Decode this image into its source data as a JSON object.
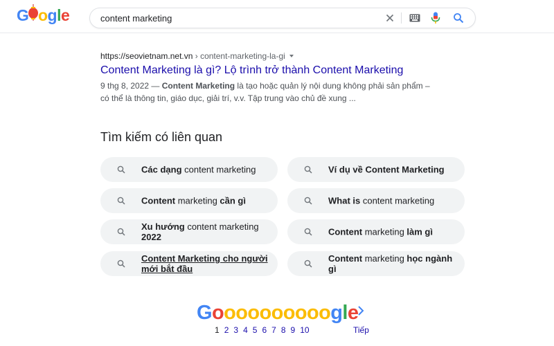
{
  "logo": {
    "text": "Google"
  },
  "search": {
    "query": "content marketing"
  },
  "result": {
    "domain": "https://seovietnam.net.vn",
    "path": " › content-marketing-la-gi",
    "title": "Content Marketing là gì? Lộ trình trở thành Content Marketing",
    "date": "9 thg 8, 2022 — ",
    "snippet_bold": "Content Marketing",
    "snippet_rest": " là tạo hoặc quản lý nội dung không phải sản phẩm – có thể là thông tin, giáo dục, giải trí, v.v. Tập trung vào chủ đề xung ..."
  },
  "related": {
    "title": "Tìm kiếm có liên quan",
    "items": [
      {
        "parts": [
          {
            "t": "Các dạng",
            "b": true
          },
          {
            "t": " content marketing",
            "b": false
          }
        ]
      },
      {
        "parts": [
          {
            "t": "Ví dụ về Content Marketing",
            "b": true
          }
        ]
      },
      {
        "parts": [
          {
            "t": "Content",
            "b": true
          },
          {
            "t": " marketing ",
            "b": false
          },
          {
            "t": "cần gì",
            "b": true
          }
        ]
      },
      {
        "parts": [
          {
            "t": "What is",
            "b": true
          },
          {
            "t": " content marketing",
            "b": false
          }
        ]
      },
      {
        "parts": [
          {
            "t": "Xu hướng",
            "b": true
          },
          {
            "t": " content marketing ",
            "b": false
          },
          {
            "t": "2022",
            "b": true
          }
        ]
      },
      {
        "parts": [
          {
            "t": "Content",
            "b": true
          },
          {
            "t": " marketing ",
            "b": false
          },
          {
            "t": "làm gì",
            "b": true
          }
        ]
      },
      {
        "parts": [
          {
            "t": "Content Marketing cho người mới bắt đầu",
            "b": true
          }
        ],
        "underline": true
      },
      {
        "parts": [
          {
            "t": "Content",
            "b": true
          },
          {
            "t": " marketing ",
            "b": false
          },
          {
            "t": "học ngành gì",
            "b": true
          }
        ]
      }
    ]
  },
  "pagination": {
    "logo_text": "Goooooooooogle",
    "pages": [
      "1",
      "2",
      "3",
      "4",
      "5",
      "6",
      "7",
      "8",
      "9",
      "10"
    ],
    "current": "1",
    "next_label": "Tiếp"
  }
}
